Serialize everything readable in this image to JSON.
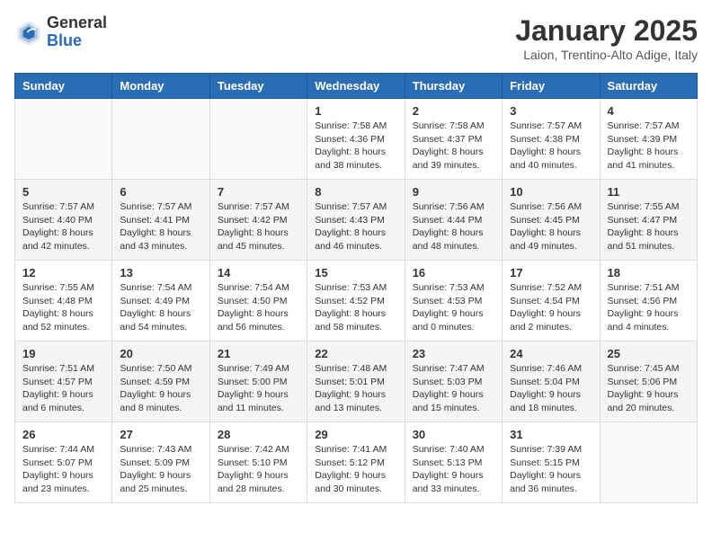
{
  "header": {
    "logo_general": "General",
    "logo_blue": "Blue",
    "month_title": "January 2025",
    "location": "Laion, Trentino-Alto Adige, Italy"
  },
  "weekdays": [
    "Sunday",
    "Monday",
    "Tuesday",
    "Wednesday",
    "Thursday",
    "Friday",
    "Saturday"
  ],
  "weeks": [
    [
      {
        "day": "",
        "info": ""
      },
      {
        "day": "",
        "info": ""
      },
      {
        "day": "",
        "info": ""
      },
      {
        "day": "1",
        "info": "Sunrise: 7:58 AM\nSunset: 4:36 PM\nDaylight: 8 hours\nand 38 minutes."
      },
      {
        "day": "2",
        "info": "Sunrise: 7:58 AM\nSunset: 4:37 PM\nDaylight: 8 hours\nand 39 minutes."
      },
      {
        "day": "3",
        "info": "Sunrise: 7:57 AM\nSunset: 4:38 PM\nDaylight: 8 hours\nand 40 minutes."
      },
      {
        "day": "4",
        "info": "Sunrise: 7:57 AM\nSunset: 4:39 PM\nDaylight: 8 hours\nand 41 minutes."
      }
    ],
    [
      {
        "day": "5",
        "info": "Sunrise: 7:57 AM\nSunset: 4:40 PM\nDaylight: 8 hours\nand 42 minutes."
      },
      {
        "day": "6",
        "info": "Sunrise: 7:57 AM\nSunset: 4:41 PM\nDaylight: 8 hours\nand 43 minutes."
      },
      {
        "day": "7",
        "info": "Sunrise: 7:57 AM\nSunset: 4:42 PM\nDaylight: 8 hours\nand 45 minutes."
      },
      {
        "day": "8",
        "info": "Sunrise: 7:57 AM\nSunset: 4:43 PM\nDaylight: 8 hours\nand 46 minutes."
      },
      {
        "day": "9",
        "info": "Sunrise: 7:56 AM\nSunset: 4:44 PM\nDaylight: 8 hours\nand 48 minutes."
      },
      {
        "day": "10",
        "info": "Sunrise: 7:56 AM\nSunset: 4:45 PM\nDaylight: 8 hours\nand 49 minutes."
      },
      {
        "day": "11",
        "info": "Sunrise: 7:55 AM\nSunset: 4:47 PM\nDaylight: 8 hours\nand 51 minutes."
      }
    ],
    [
      {
        "day": "12",
        "info": "Sunrise: 7:55 AM\nSunset: 4:48 PM\nDaylight: 8 hours\nand 52 minutes."
      },
      {
        "day": "13",
        "info": "Sunrise: 7:54 AM\nSunset: 4:49 PM\nDaylight: 8 hours\nand 54 minutes."
      },
      {
        "day": "14",
        "info": "Sunrise: 7:54 AM\nSunset: 4:50 PM\nDaylight: 8 hours\nand 56 minutes."
      },
      {
        "day": "15",
        "info": "Sunrise: 7:53 AM\nSunset: 4:52 PM\nDaylight: 8 hours\nand 58 minutes."
      },
      {
        "day": "16",
        "info": "Sunrise: 7:53 AM\nSunset: 4:53 PM\nDaylight: 9 hours\nand 0 minutes."
      },
      {
        "day": "17",
        "info": "Sunrise: 7:52 AM\nSunset: 4:54 PM\nDaylight: 9 hours\nand 2 minutes."
      },
      {
        "day": "18",
        "info": "Sunrise: 7:51 AM\nSunset: 4:56 PM\nDaylight: 9 hours\nand 4 minutes."
      }
    ],
    [
      {
        "day": "19",
        "info": "Sunrise: 7:51 AM\nSunset: 4:57 PM\nDaylight: 9 hours\nand 6 minutes."
      },
      {
        "day": "20",
        "info": "Sunrise: 7:50 AM\nSunset: 4:59 PM\nDaylight: 9 hours\nand 8 minutes."
      },
      {
        "day": "21",
        "info": "Sunrise: 7:49 AM\nSunset: 5:00 PM\nDaylight: 9 hours\nand 11 minutes."
      },
      {
        "day": "22",
        "info": "Sunrise: 7:48 AM\nSunset: 5:01 PM\nDaylight: 9 hours\nand 13 minutes."
      },
      {
        "day": "23",
        "info": "Sunrise: 7:47 AM\nSunset: 5:03 PM\nDaylight: 9 hours\nand 15 minutes."
      },
      {
        "day": "24",
        "info": "Sunrise: 7:46 AM\nSunset: 5:04 PM\nDaylight: 9 hours\nand 18 minutes."
      },
      {
        "day": "25",
        "info": "Sunrise: 7:45 AM\nSunset: 5:06 PM\nDaylight: 9 hours\nand 20 minutes."
      }
    ],
    [
      {
        "day": "26",
        "info": "Sunrise: 7:44 AM\nSunset: 5:07 PM\nDaylight: 9 hours\nand 23 minutes."
      },
      {
        "day": "27",
        "info": "Sunrise: 7:43 AM\nSunset: 5:09 PM\nDaylight: 9 hours\nand 25 minutes."
      },
      {
        "day": "28",
        "info": "Sunrise: 7:42 AM\nSunset: 5:10 PM\nDaylight: 9 hours\nand 28 minutes."
      },
      {
        "day": "29",
        "info": "Sunrise: 7:41 AM\nSunset: 5:12 PM\nDaylight: 9 hours\nand 30 minutes."
      },
      {
        "day": "30",
        "info": "Sunrise: 7:40 AM\nSunset: 5:13 PM\nDaylight: 9 hours\nand 33 minutes."
      },
      {
        "day": "31",
        "info": "Sunrise: 7:39 AM\nSunset: 5:15 PM\nDaylight: 9 hours\nand 36 minutes."
      },
      {
        "day": "",
        "info": ""
      }
    ]
  ]
}
